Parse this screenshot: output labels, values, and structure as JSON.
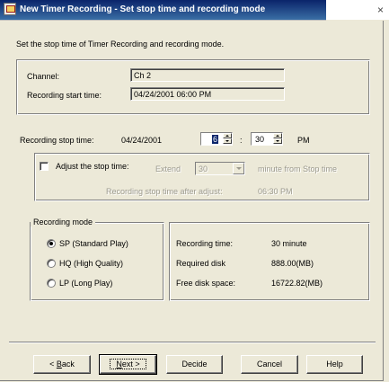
{
  "window": {
    "title": "New Timer Recording - Set stop time and recording mode",
    "close_glyph": "×"
  },
  "description": "Set the stop time of Timer Recording and recording mode.",
  "channel": {
    "label": "Channel:",
    "value": "Ch 2"
  },
  "start_time": {
    "label": "Recording start time:",
    "value": "04/24/2001 06:00 PM"
  },
  "stop_time": {
    "label": "Recording stop time:",
    "date": "04/24/2001",
    "hour": "6",
    "separator": ":",
    "minute": "30",
    "ampm": "PM"
  },
  "adjust": {
    "checkbox_label": "Adjust the stop time:",
    "extend_label": "Extend",
    "extend_value": "30",
    "extend_suffix": "minute from Stop time",
    "after_label": "Recording  stop time after adjust:",
    "after_value": "06:30 PM"
  },
  "recording_mode": {
    "legend": "Recording mode",
    "options": [
      {
        "label": "SP (Standard Play)",
        "selected": true
      },
      {
        "label": "HQ (High Quality)",
        "selected": false
      },
      {
        "label": "LP (Long Play)",
        "selected": false
      }
    ]
  },
  "info": {
    "recording_time_label": "Recording time:",
    "recording_time_value": "30 minute",
    "required_disk_label": "Required disk",
    "required_disk_value": "888.00(MB)",
    "free_disk_label": "Free disk space:",
    "free_disk_value": "16722.82(MB)"
  },
  "buttons": {
    "back_prefix": "< ",
    "back_key": "B",
    "back_rest": "ack",
    "next_key": "N",
    "next_rest": "ext >",
    "decide": "Decide",
    "cancel": "Cancel",
    "help": "Help"
  },
  "icons": [
    "app-icon",
    "close-icon",
    "spin-up-icon",
    "spin-down-icon",
    "dropdown-arrow-icon"
  ]
}
